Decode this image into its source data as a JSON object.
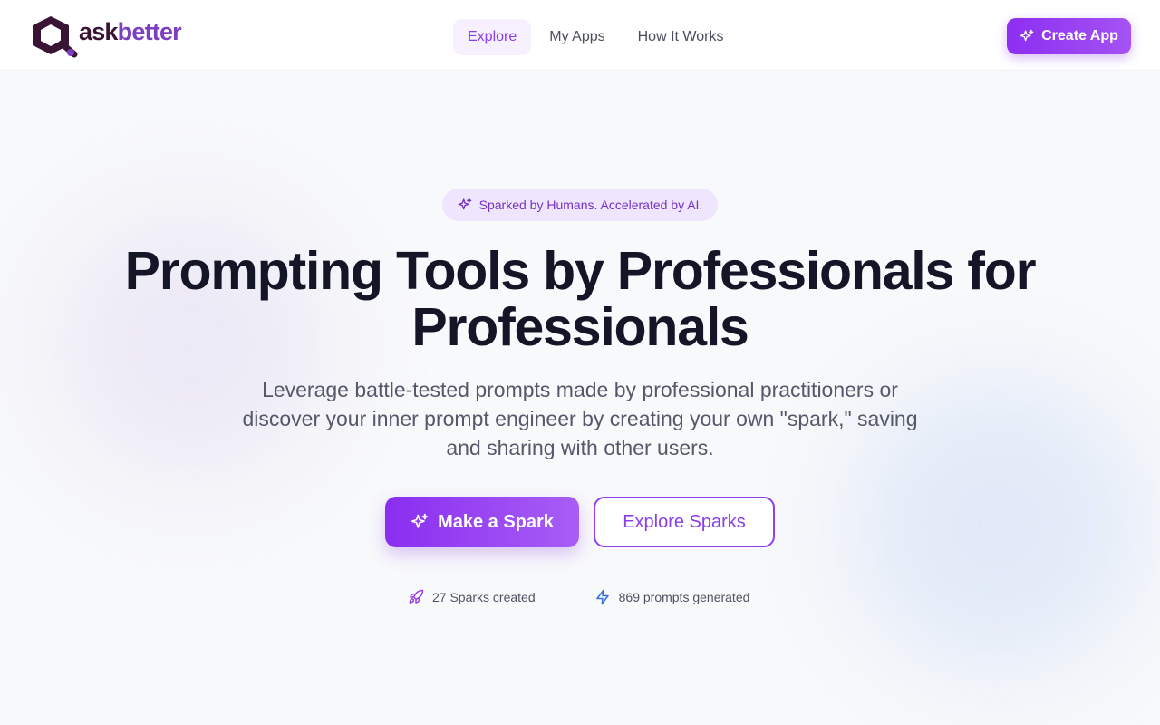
{
  "brand": {
    "name_part1": "ask",
    "name_part2": "better",
    "accent": "#8b3df0",
    "dark": "#3a1434"
  },
  "nav": {
    "items": [
      {
        "label": "Explore",
        "active": true
      },
      {
        "label": "My Apps",
        "active": false
      },
      {
        "label": "How It Works",
        "active": false
      }
    ],
    "create_label": "Create App"
  },
  "hero": {
    "badge": "Sparked by Humans. Accelerated by AI.",
    "title": "Prompting Tools by Professionals for Professionals",
    "subtitle": "Leverage battle-tested prompts made by professional practitioners or discover your inner prompt engineer by creating your own \"spark,\" saving and sharing with other users.",
    "primary_cta": "Make a Spark",
    "secondary_cta": "Explore Sparks"
  },
  "stats": [
    {
      "icon": "rocket-icon",
      "text": "27 Sparks created"
    },
    {
      "icon": "lightning-icon",
      "text": "869 prompts generated"
    }
  ]
}
